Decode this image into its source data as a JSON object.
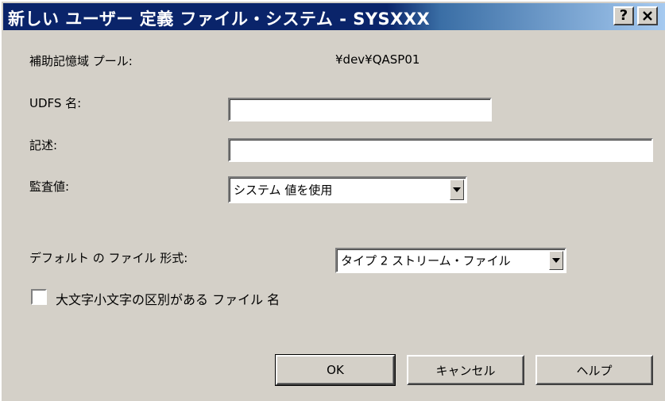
{
  "window": {
    "title": "新しい ユーザー 定義 ファイル・システム - SYSXXX",
    "help_button": "?",
    "close_button": "X"
  },
  "form": {
    "asp_label": "補助記憶域 プール:",
    "asp_value": "¥dev¥QASP01",
    "udfs_name_label": "UDFS 名:",
    "udfs_name_value": "",
    "description_label": "記述:",
    "description_value": "",
    "audit_label": "監査値:",
    "audit_value": "システム 値を使用",
    "default_format_label": "デフォルト の ファイル 形式:",
    "default_format_value": "タイプ 2 ストリーム・ファイル",
    "case_sensitive_label": "大文字小文字の区別がある ファイル 名",
    "case_sensitive_checked": false
  },
  "buttons": {
    "ok": "OK",
    "cancel": "キャンセル",
    "help": "ヘルプ"
  },
  "colors": {
    "titlebar_start": "#0a246a",
    "titlebar_end": "#a6caf0",
    "face": "#d4d0c8"
  }
}
